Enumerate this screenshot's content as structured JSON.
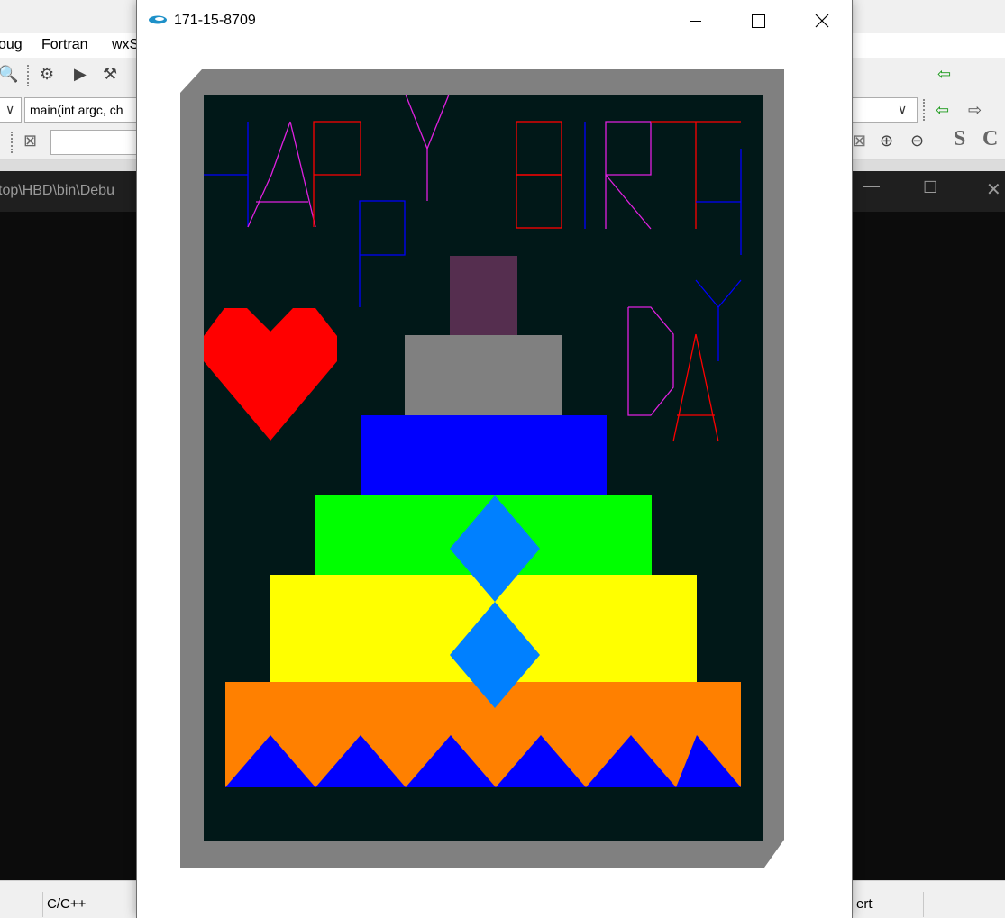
{
  "ide": {
    "menus": [
      {
        "label": "oug"
      },
      {
        "label": "Fortran"
      },
      {
        "label": "wxS"
      }
    ],
    "function_combo": {
      "value": "main(int argc, ch"
    },
    "console_path": "top\\HBD\\bin\\Debu",
    "status": {
      "language": "C/C++",
      "mode": "ert"
    }
  },
  "window": {
    "title": "171-15-8709",
    "minimize_glyph": "—",
    "maximize_glyph": "☐",
    "close_glyph": "✕"
  },
  "card": {
    "letters": [
      "H",
      "A",
      "P",
      "P",
      "Y",
      "B",
      "I",
      "R",
      "T",
      "H",
      "D",
      "A",
      "Y"
    ],
    "colors": {
      "frame": "#808080",
      "board": "#011818",
      "heart": "#ff0000",
      "candle": "#552e4f",
      "tier_1": "#808080",
      "tier_2": "#0000ff",
      "tier_3": "#00ff00",
      "tier_4": "#ffff00",
      "tier_5": "#ff8000",
      "diamond": "#0080ff",
      "triangles": "#0000ff",
      "letter_blue": "#0000ff",
      "letter_magenta": "#e020e0",
      "letter_red": "#ff0000"
    }
  }
}
